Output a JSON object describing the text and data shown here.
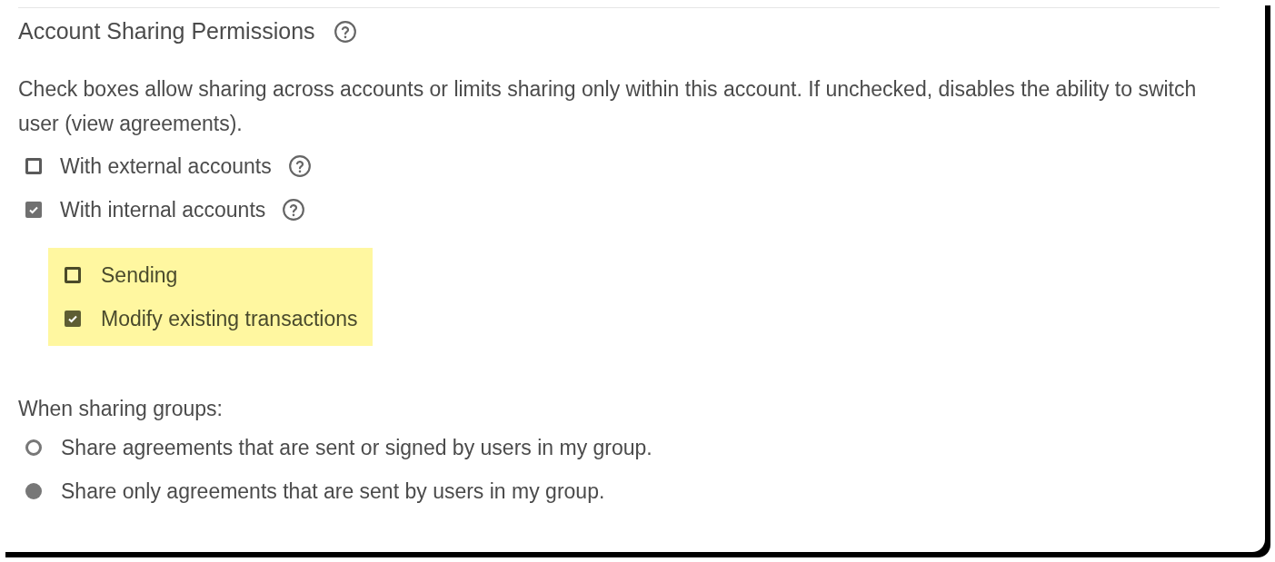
{
  "section": {
    "title": "Account Sharing Permissions",
    "has_help": true
  },
  "description": "Check boxes allow sharing across accounts or limits sharing only within this account. If unchecked, disables the ability to switch user (view agreements).",
  "options": [
    {
      "label": "With external accounts",
      "checked": false,
      "has_help": true
    },
    {
      "label": "With internal accounts",
      "checked": true,
      "has_help": true,
      "highlighted": true,
      "children": [
        {
          "label": "Sending",
          "checked": false
        },
        {
          "label": "Modify existing transactions",
          "checked": true
        }
      ]
    }
  ],
  "groups": {
    "label": "When sharing groups:",
    "options": [
      {
        "label": "Share agreements that are sent or signed by users in my group.",
        "selected": false
      },
      {
        "label": "Share only agreements that are sent by users in my group.",
        "selected": true
      }
    ]
  }
}
